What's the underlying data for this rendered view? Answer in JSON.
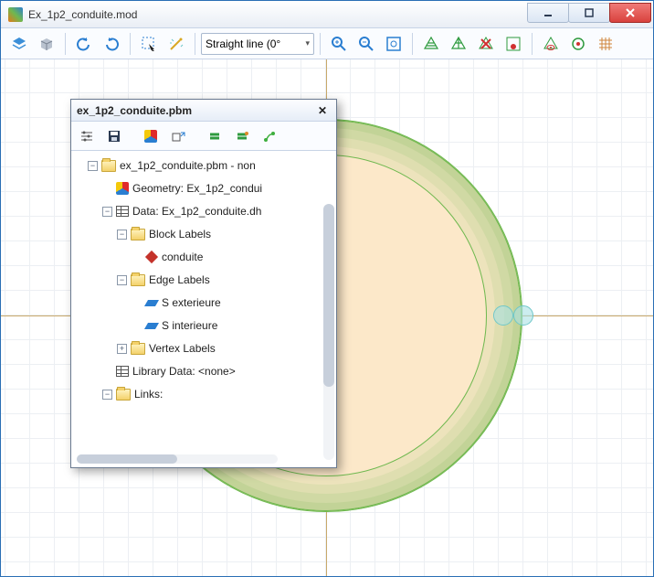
{
  "window": {
    "title": "Ex_1p2_conduite.mod"
  },
  "toolbar": {
    "linetype_label": "Straight line (0°"
  },
  "panel": {
    "title": "ex_1p2_conduite.pbm"
  },
  "tree": {
    "root": "ex_1p2_conduite.pbm - non",
    "geometry": "Geometry: Ex_1p2_condui",
    "data": "Data: Ex_1p2_conduite.dh",
    "block_labels": "Block Labels",
    "block_item": "conduite",
    "edge_labels": "Edge Labels",
    "edge_item1": "S exterieure",
    "edge_item2": "S interieure",
    "vertex_labels": "Vertex Labels",
    "library": "Library Data: <none>",
    "links": "Links:"
  }
}
